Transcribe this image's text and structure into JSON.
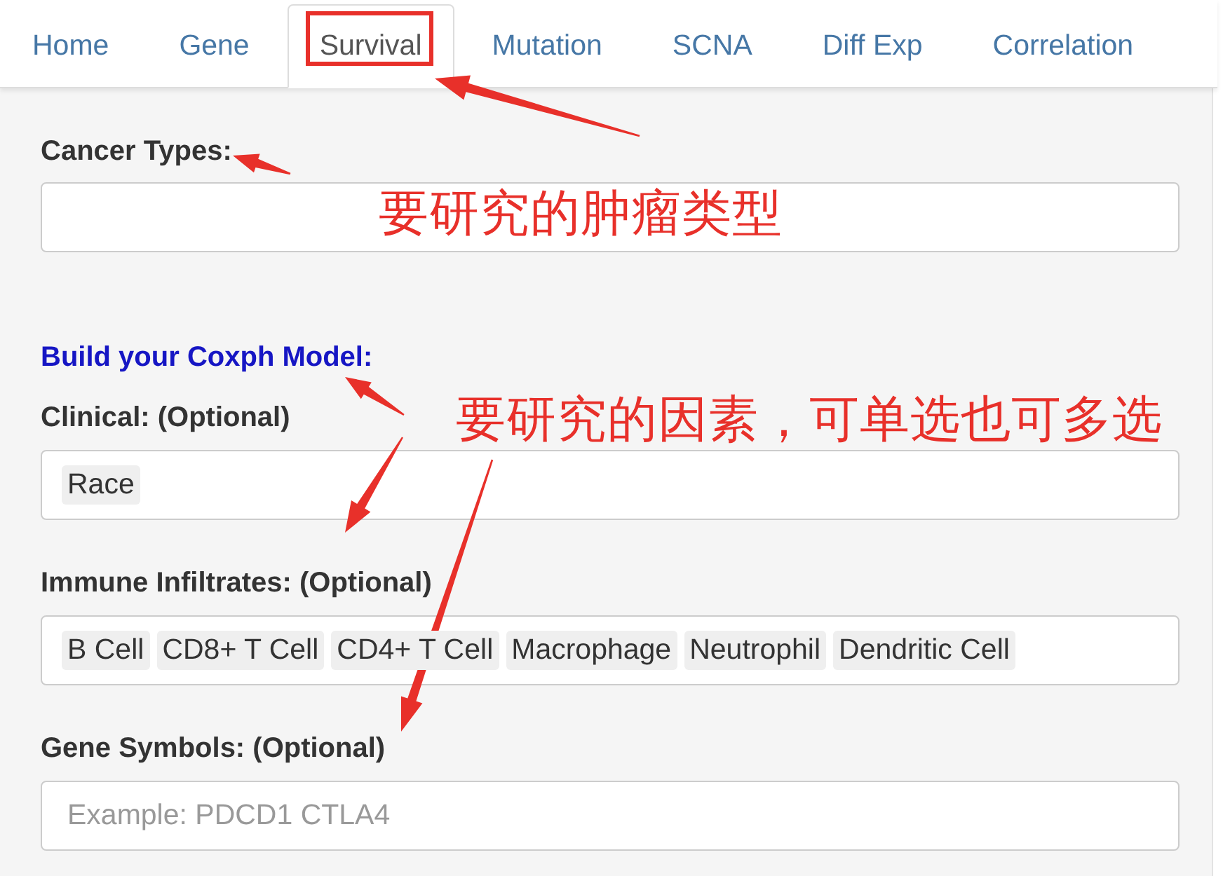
{
  "tabs": [
    {
      "label": "Home",
      "selected": false,
      "highlighted": false
    },
    {
      "label": "Gene",
      "selected": false,
      "highlighted": false
    },
    {
      "label": "Survival",
      "selected": true,
      "highlighted": true
    },
    {
      "label": "Mutation",
      "selected": false,
      "highlighted": false
    },
    {
      "label": "SCNA",
      "selected": false,
      "highlighted": false
    },
    {
      "label": "Diff Exp",
      "selected": false,
      "highlighted": false
    },
    {
      "label": "Correlation",
      "selected": false,
      "highlighted": false
    }
  ],
  "form": {
    "cancer_types": {
      "label": "Cancer Types:"
    },
    "model_heading": "Build your Coxph Model:",
    "fields": [
      {
        "label": "Clinical: (Optional)",
        "tags": [
          "Race"
        ]
      },
      {
        "label": "Immune Infiltrates: (Optional)",
        "tags": [
          "B Cell",
          "CD8+ T Cell",
          "CD4+ T Cell",
          "Macrophage",
          "Neutrophil",
          "Dendritic Cell"
        ]
      },
      {
        "label": "Gene Symbols: (Optional)",
        "placeholder": "Example: PDCD1 CTLA4"
      }
    ]
  },
  "annotations": [
    {
      "text": "要研究的肿瘤类型"
    },
    {
      "text": "要研究的因素，可单选也可多选"
    }
  ]
}
